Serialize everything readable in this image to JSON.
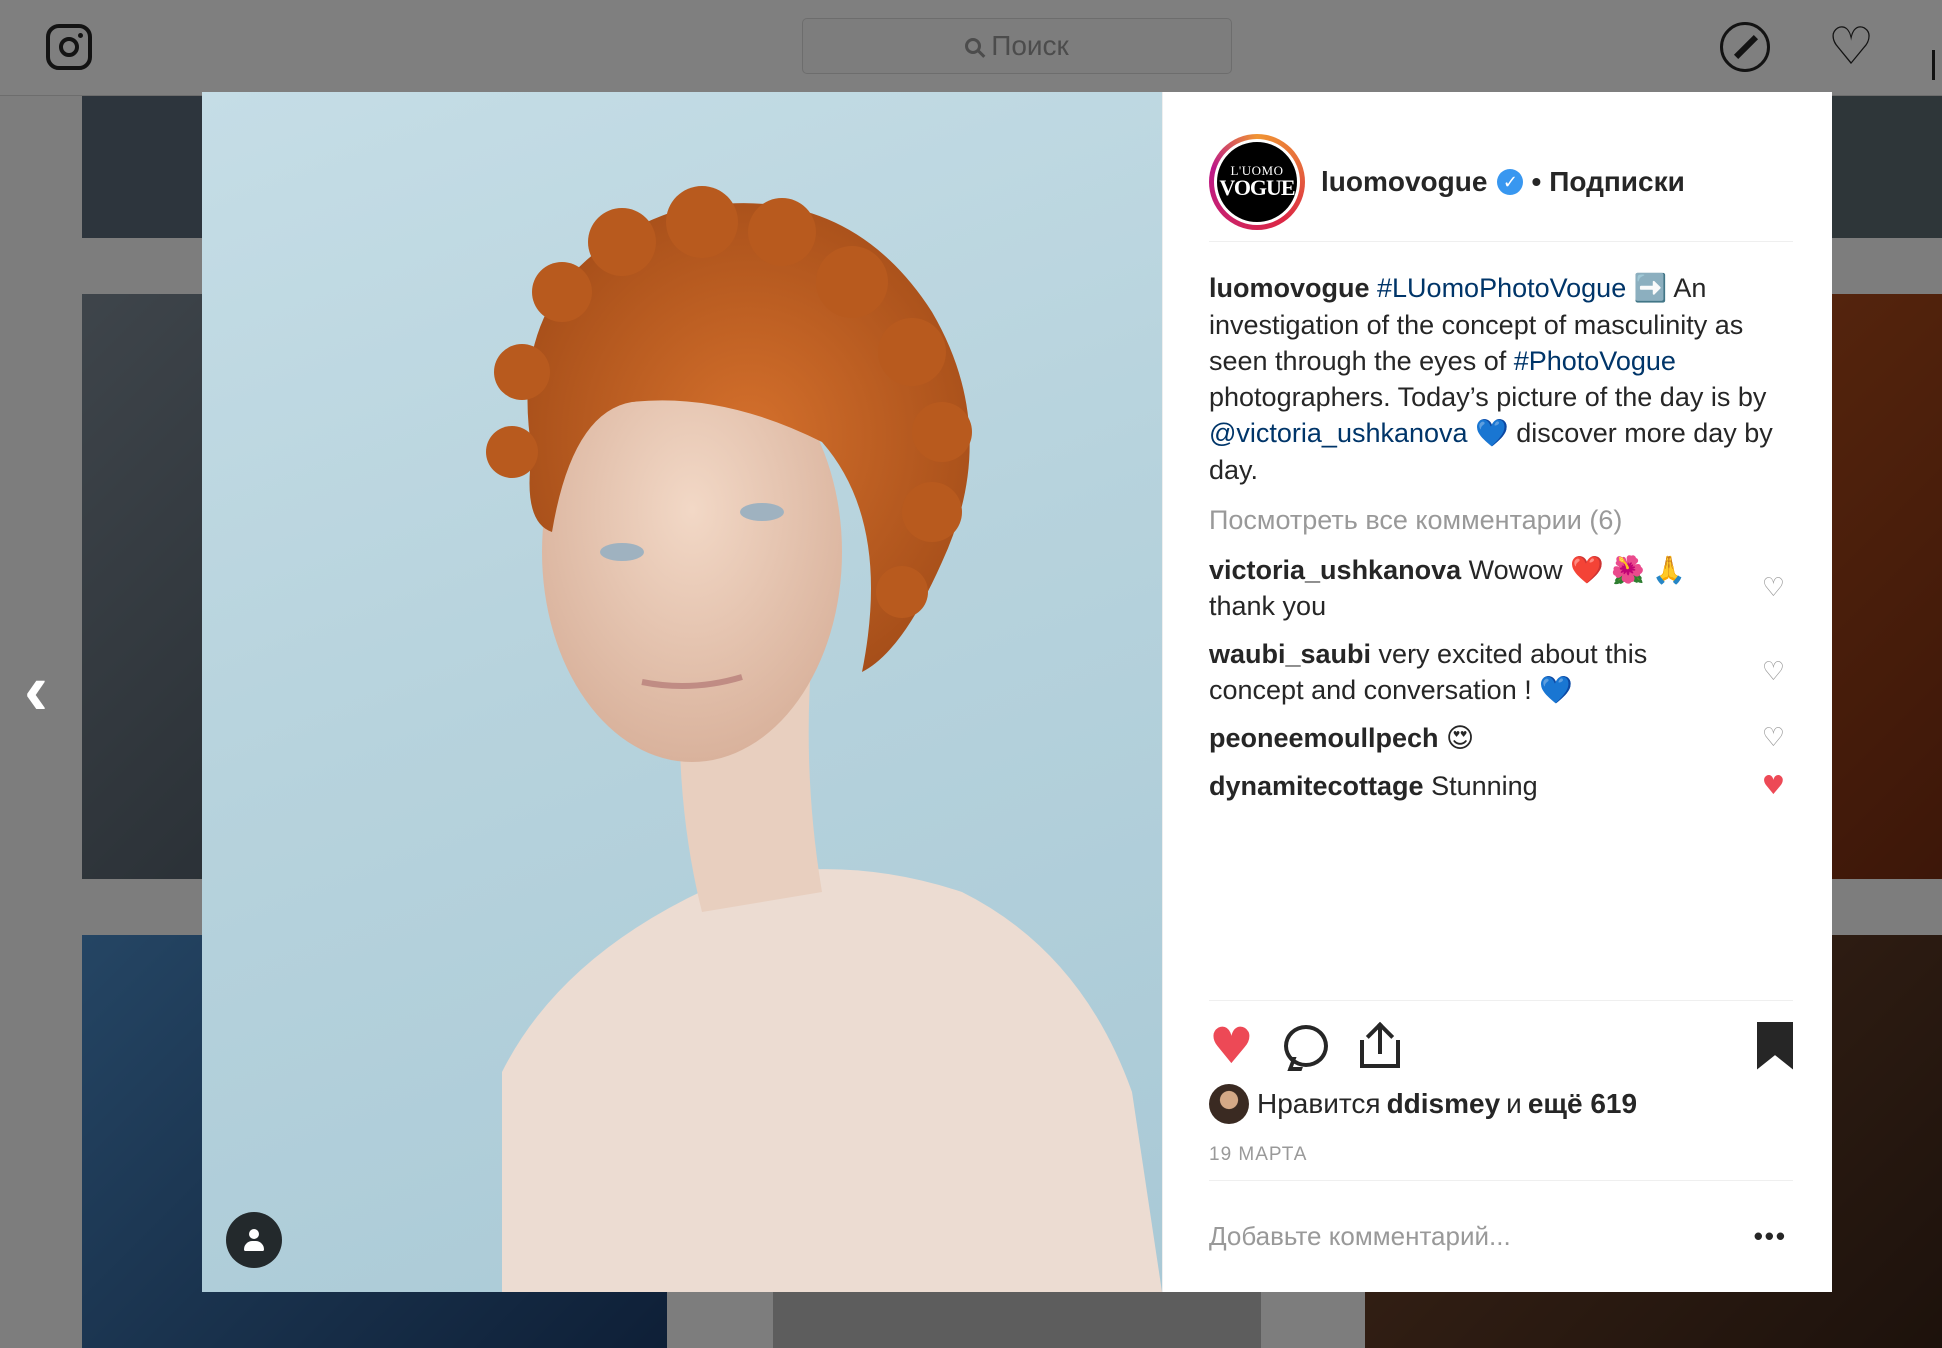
{
  "header": {
    "search_placeholder": "Поиск",
    "icons": [
      "instagram-icon",
      "search-icon",
      "compass-icon",
      "heart-icon"
    ]
  },
  "post": {
    "username": "luomovogue",
    "avatar_text_1": "L'UOMO",
    "avatar_text_2": "VOGUE",
    "verified": true,
    "dot": "•",
    "follow_label": "Подписки",
    "caption": {
      "user": "luomovogue",
      "hashtag1": "#LUomoPhotoVogue",
      "emoji1": "➡️",
      "text1": " An investigation of the concept of masculinity as seen through the eyes of ",
      "hashtag2": "#PhotoVogue",
      "text2": " photographers. Today’s picture of the day is by ",
      "mention": "@victoria_ushkanova",
      "emoji2": "💙",
      "text3": "  discover more day by day."
    },
    "view_all": "Посмотреть все комментарии (6)",
    "comments": [
      {
        "user": "victoria_ushkanova",
        "text": " Wowow ❤️ 🌺 🙏 thank you",
        "liked": false
      },
      {
        "user": "waubi_saubi",
        "text": " very excited about this concept and conversation ! 💙",
        "liked": false
      },
      {
        "user": "peoneemoullpech",
        "text": " 😍",
        "liked": false
      },
      {
        "user": "dynamitecottage",
        "text": " Stunning",
        "liked": true
      }
    ],
    "likes": {
      "prefix": "Нравится ",
      "user": "ddismey",
      "middle": " и ",
      "rest": "ещё 619"
    },
    "date": "19 МАРТА",
    "add_comment_placeholder": "Добавьте комментарий...",
    "more": "•••",
    "liked_by_me": true,
    "colors": {
      "like": "#ed4956",
      "link": "#003569",
      "muted": "#999999",
      "verified": "#3897f0"
    }
  }
}
